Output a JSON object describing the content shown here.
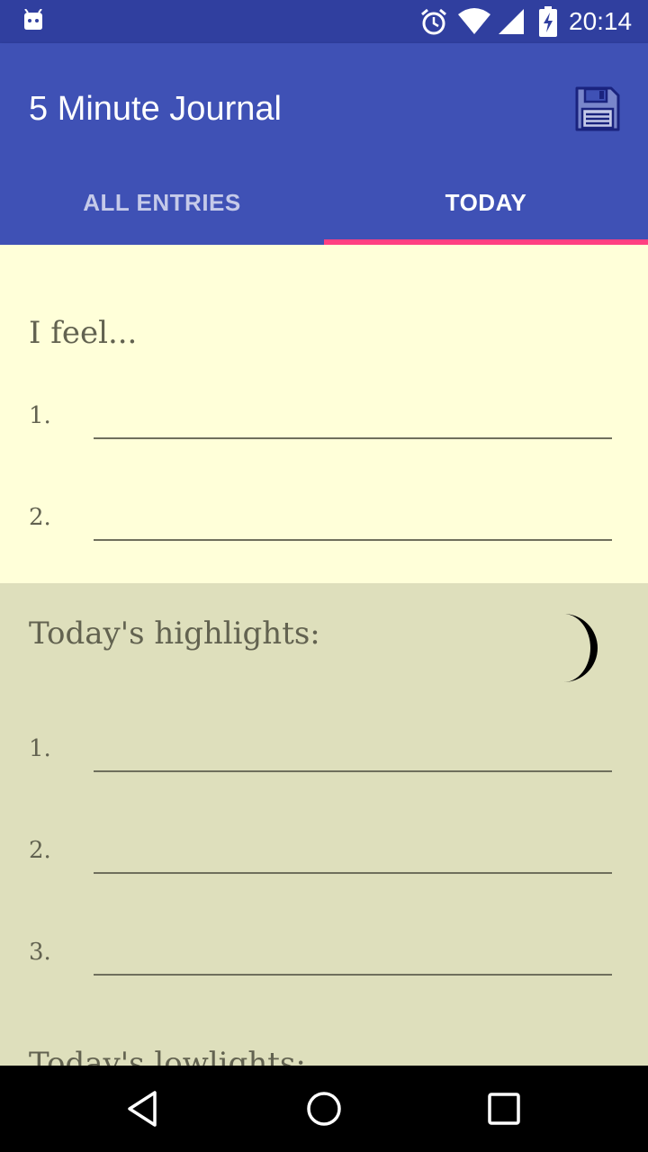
{
  "status_bar": {
    "time": "20:14",
    "icons": [
      "android-debug-icon",
      "alarm-icon",
      "wifi-icon",
      "signal-icon",
      "battery-charging-icon"
    ]
  },
  "app_bar": {
    "title": "5 Minute Journal",
    "save_icon": "floppy-disk-save-icon",
    "colors": {
      "primary": "#3f51b5",
      "primary_dark": "#303f9f",
      "accent": "#ff4081"
    }
  },
  "tabs": [
    {
      "label": "ALL ENTRIES",
      "selected": false
    },
    {
      "label": "TODAY",
      "selected": true
    }
  ],
  "sections": {
    "feel": {
      "heading": "I feel...",
      "items": [
        {
          "number": "1.",
          "value": ""
        },
        {
          "number": "2.",
          "value": ""
        }
      ],
      "background": "#ffffd9"
    },
    "highlights": {
      "heading": "Today's highlights:",
      "icon": "crescent-moon-icon",
      "items": [
        {
          "number": "1.",
          "value": ""
        },
        {
          "number": "2.",
          "value": ""
        },
        {
          "number": "3.",
          "value": ""
        }
      ],
      "background": "#dedfbc"
    },
    "lowlights": {
      "heading": "Today's lowlights:"
    }
  },
  "nav_bar": {
    "icons": [
      "back-icon",
      "home-icon",
      "recents-icon"
    ]
  }
}
